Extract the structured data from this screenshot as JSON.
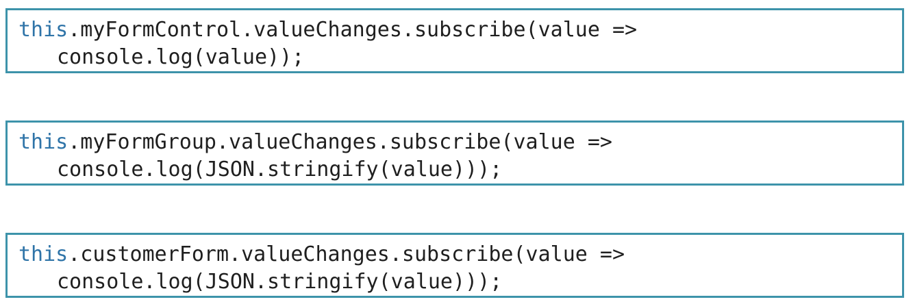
{
  "snippets": [
    {
      "keyword": "this",
      "line1_rest": ".myFormControl.valueChanges.subscribe(value =>",
      "line2": "console.log(value));"
    },
    {
      "keyword": "this",
      "line1_rest": ".myFormGroup.valueChanges.subscribe(value =>",
      "line2": "console.log(JSON.stringify(value)));"
    },
    {
      "keyword": "this",
      "line1_rest": ".customerForm.valueChanges.subscribe(value =>",
      "line2": "console.log(JSON.stringify(value)));"
    }
  ],
  "colors": {
    "keyword": "#2f74a8",
    "border": "#3d93aa",
    "text": "#1f1f1f"
  }
}
